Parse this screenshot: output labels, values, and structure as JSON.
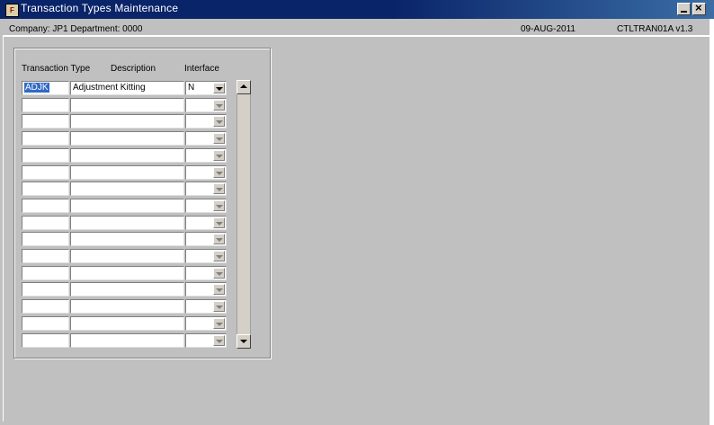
{
  "window": {
    "title": "Transaction Types Maintenance",
    "icon": "form-app-icon"
  },
  "info_bar": {
    "company_department": "Company:  JP1    Department:  0000",
    "date": "09-AUG-2011",
    "form_version": "CTLTRAN01A  v1.3"
  },
  "table": {
    "headers": {
      "transaction_type": "Transaction Type",
      "description": "Description",
      "interface": "Interface"
    },
    "rows": [
      {
        "code": "ADJK",
        "description": "Adjustment Kitting",
        "interface": "N",
        "selected": true
      },
      {
        "code": "",
        "description": "",
        "interface": ""
      },
      {
        "code": "",
        "description": "",
        "interface": ""
      },
      {
        "code": "",
        "description": "",
        "interface": ""
      },
      {
        "code": "",
        "description": "",
        "interface": ""
      },
      {
        "code": "",
        "description": "",
        "interface": ""
      },
      {
        "code": "",
        "description": "",
        "interface": ""
      },
      {
        "code": "",
        "description": "",
        "interface": ""
      },
      {
        "code": "",
        "description": "",
        "interface": ""
      },
      {
        "code": "",
        "description": "",
        "interface": ""
      },
      {
        "code": "",
        "description": "",
        "interface": ""
      },
      {
        "code": "",
        "description": "",
        "interface": ""
      },
      {
        "code": "",
        "description": "",
        "interface": ""
      },
      {
        "code": "",
        "description": "",
        "interface": ""
      },
      {
        "code": "",
        "description": "",
        "interface": ""
      },
      {
        "code": "",
        "description": "",
        "interface": ""
      }
    ]
  },
  "colors": {
    "title_bar": "#0a246a",
    "background": "#c0c0c0",
    "selection": "#316ac5"
  }
}
